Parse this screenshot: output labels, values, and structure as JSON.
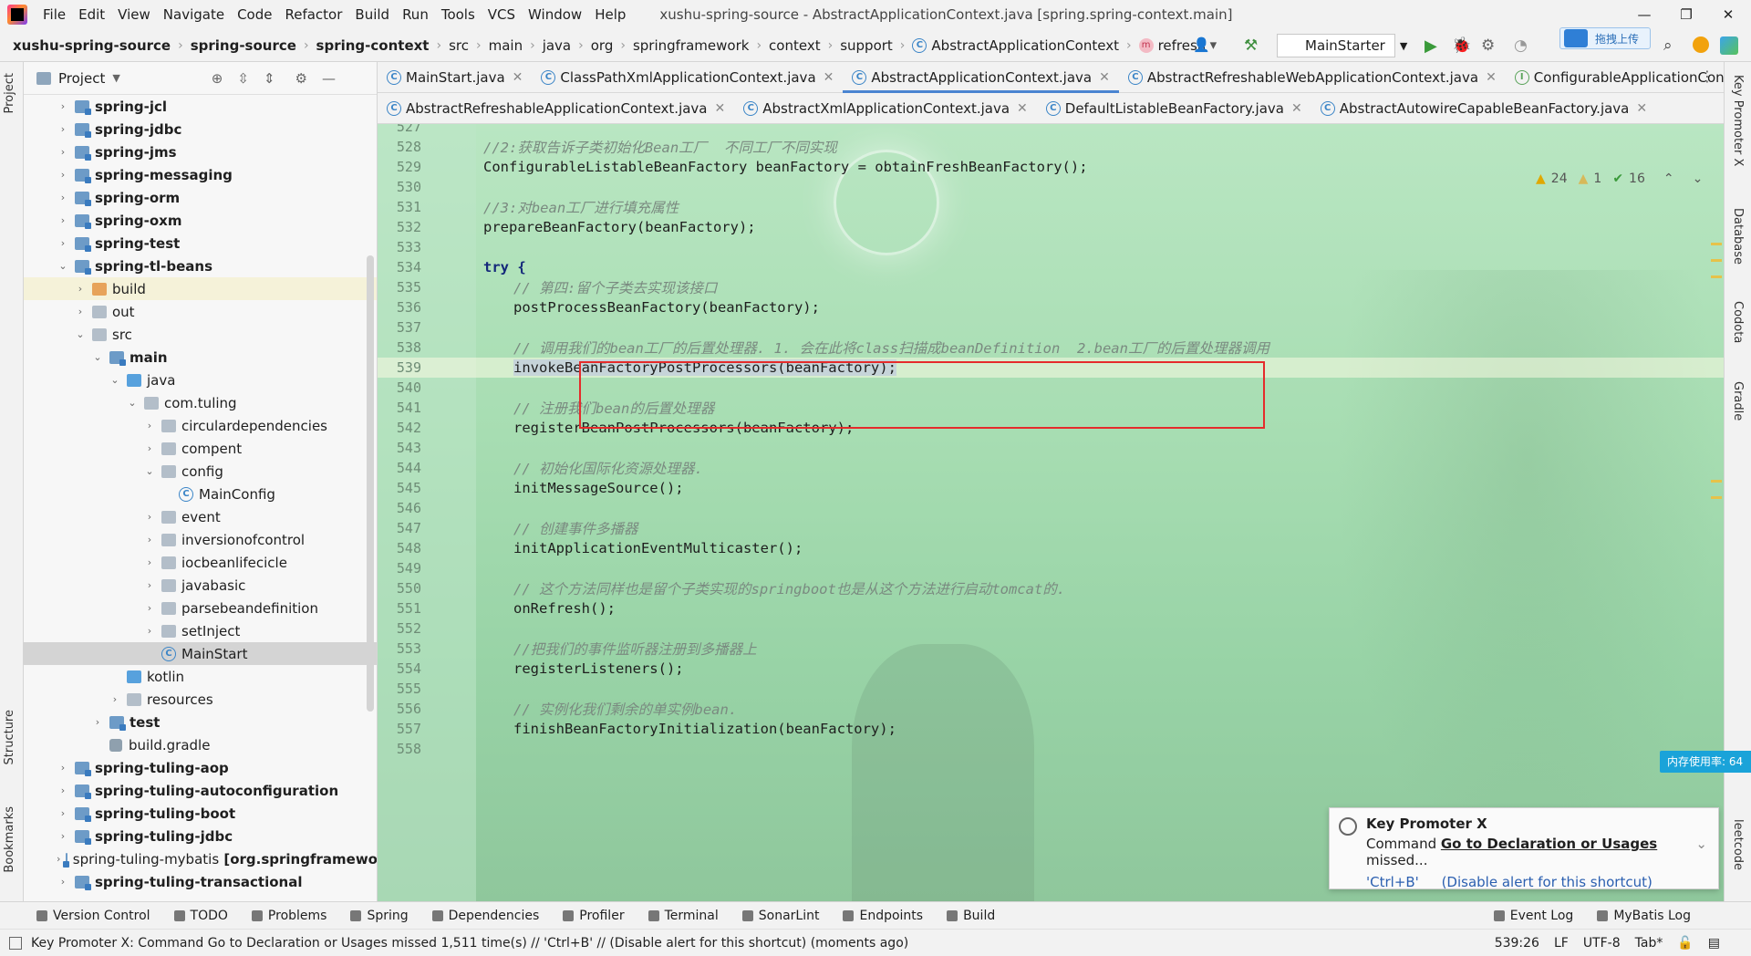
{
  "menubar": {
    "items": [
      "File",
      "Edit",
      "View",
      "Navigate",
      "Code",
      "Refactor",
      "Build",
      "Run",
      "Tools",
      "VCS",
      "Window",
      "Help"
    ],
    "title": "xushu-spring-source - AbstractApplicationContext.java [spring.spring-context.main]"
  },
  "navbar": {
    "crumbs": [
      "xushu-spring-source",
      "spring-source",
      "spring-context",
      "src",
      "main",
      "java",
      "org",
      "springframework",
      "context",
      "support"
    ],
    "class_name": "AbstractApplicationContext",
    "method_name": "refresh",
    "run_config": "MainStarter",
    "upload_badge": "拖拽上传"
  },
  "project": {
    "title": "Project",
    "tree": [
      {
        "label": "spring-jcl",
        "depth": 0,
        "type": "mod",
        "arrow": "›",
        "bold": true
      },
      {
        "label": "spring-jdbc",
        "depth": 0,
        "type": "mod",
        "arrow": "›",
        "bold": true
      },
      {
        "label": "spring-jms",
        "depth": 0,
        "type": "mod",
        "arrow": "›",
        "bold": true
      },
      {
        "label": "spring-messaging",
        "depth": 0,
        "type": "mod",
        "arrow": "›",
        "bold": true
      },
      {
        "label": "spring-orm",
        "depth": 0,
        "type": "mod",
        "arrow": "›",
        "bold": true
      },
      {
        "label": "spring-oxm",
        "depth": 0,
        "type": "mod",
        "arrow": "›",
        "bold": true
      },
      {
        "label": "spring-test",
        "depth": 0,
        "type": "mod",
        "arrow": "›",
        "bold": true
      },
      {
        "label": "spring-tl-beans",
        "depth": 0,
        "type": "mod",
        "arrow": "⌄",
        "bold": true
      },
      {
        "label": "build",
        "depth": 1,
        "type": "orange",
        "arrow": "›",
        "bold": false,
        "hl": true
      },
      {
        "label": "out",
        "depth": 1,
        "type": "plain",
        "arrow": "›",
        "bold": false
      },
      {
        "label": "src",
        "depth": 1,
        "type": "plain",
        "arrow": "⌄",
        "bold": false
      },
      {
        "label": "main",
        "depth": 2,
        "type": "mod",
        "arrow": "⌄",
        "bold": true
      },
      {
        "label": "java",
        "depth": 3,
        "type": "src",
        "arrow": "⌄",
        "bold": false
      },
      {
        "label": "com.tuling",
        "depth": 4,
        "type": "plain",
        "arrow": "⌄",
        "bold": false
      },
      {
        "label": "circulardependencies",
        "depth": 5,
        "type": "plain",
        "arrow": "›",
        "bold": false
      },
      {
        "label": "compent",
        "depth": 5,
        "type": "plain",
        "arrow": "›",
        "bold": false
      },
      {
        "label": "config",
        "depth": 5,
        "type": "plain",
        "arrow": "⌄",
        "bold": false
      },
      {
        "label": "MainConfig",
        "depth": 6,
        "type": "class",
        "arrow": "",
        "bold": false
      },
      {
        "label": "event",
        "depth": 5,
        "type": "plain",
        "arrow": "›",
        "bold": false
      },
      {
        "label": "inversionofcontrol",
        "depth": 5,
        "type": "plain",
        "arrow": "›",
        "bold": false
      },
      {
        "label": "iocbeanlifecicle",
        "depth": 5,
        "type": "plain",
        "arrow": "›",
        "bold": false
      },
      {
        "label": "javabasic",
        "depth": 5,
        "type": "plain",
        "arrow": "›",
        "bold": false
      },
      {
        "label": "parsebeandefinition",
        "depth": 5,
        "type": "plain",
        "arrow": "›",
        "bold": false
      },
      {
        "label": "setInject",
        "depth": 5,
        "type": "plain",
        "arrow": "›",
        "bold": false
      },
      {
        "label": "MainStart",
        "depth": 5,
        "type": "class",
        "arrow": "",
        "bold": false,
        "sel": true
      },
      {
        "label": "kotlin",
        "depth": 3,
        "type": "src",
        "arrow": "",
        "bold": false
      },
      {
        "label": "resources",
        "depth": 3,
        "type": "plain",
        "arrow": "›",
        "bold": false
      },
      {
        "label": "test",
        "depth": 2,
        "type": "mod",
        "arrow": "›",
        "bold": true
      },
      {
        "label": "build.gradle",
        "depth": 2,
        "type": "gradle",
        "arrow": "",
        "bold": false
      },
      {
        "label": "spring-tuling-aop",
        "depth": 0,
        "type": "mod",
        "arrow": "›",
        "bold": true
      },
      {
        "label": "spring-tuling-autoconfiguration",
        "depth": 0,
        "type": "mod",
        "arrow": "›",
        "bold": true
      },
      {
        "label": "spring-tuling-boot",
        "depth": 0,
        "type": "mod",
        "arrow": "›",
        "bold": true
      },
      {
        "label": "spring-tuling-jdbc",
        "depth": 0,
        "type": "mod",
        "arrow": "›",
        "bold": true
      },
      {
        "label": "spring-tuling-mybatis",
        "suffix": " [org.springframewo",
        "depth": 0,
        "type": "mod",
        "arrow": "›",
        "bold": false
      },
      {
        "label": "spring-tuling-transactional",
        "depth": 0,
        "type": "mod",
        "arrow": "›",
        "bold": true
      }
    ]
  },
  "tabs_row1": [
    {
      "label": "MainStart.java",
      "icon": "C",
      "active": false
    },
    {
      "label": "ClassPathXmlApplicationContext.java",
      "icon": "C",
      "active": false
    },
    {
      "label": "AbstractApplicationContext.java",
      "icon": "C",
      "active": true
    },
    {
      "label": "AbstractRefreshableWebApplicationContext.java",
      "icon": "C",
      "active": false
    },
    {
      "label": "ConfigurableApplicationContext.java",
      "icon": "I",
      "active": false
    }
  ],
  "tabs_row2": [
    {
      "label": "AbstractRefreshableApplicationContext.java",
      "icon": "C"
    },
    {
      "label": "AbstractXmlApplicationContext.java",
      "icon": "C"
    },
    {
      "label": "DefaultListableBeanFactory.java",
      "icon": "C"
    },
    {
      "label": "AbstractAutowireCapableBeanFactory.java",
      "icon": "C"
    }
  ],
  "inspections": {
    "warnings": "24",
    "weak": "1",
    "ok": "16"
  },
  "code_lines": [
    {
      "n": "527",
      "text": "",
      "indent": 0,
      "kind": "code"
    },
    {
      "n": "528",
      "text": "//2:获取告诉子类初始化Bean工厂  不同工厂不同实现",
      "indent": 0,
      "kind": "comment"
    },
    {
      "n": "529",
      "text": "ConfigurableListableBeanFactory beanFactory = obtainFreshBeanFactory();",
      "indent": 0,
      "kind": "code"
    },
    {
      "n": "530",
      "text": "",
      "indent": 0,
      "kind": "code"
    },
    {
      "n": "531",
      "text": "//3:对bean工厂进行填充属性",
      "indent": 0,
      "kind": "comment"
    },
    {
      "n": "532",
      "text": "prepareBeanFactory(beanFactory);",
      "indent": 0,
      "kind": "code"
    },
    {
      "n": "533",
      "text": "",
      "indent": 0,
      "kind": "code"
    },
    {
      "n": "534",
      "text": "try {",
      "indent": 0,
      "kind": "kw"
    },
    {
      "n": "535",
      "text": "// 第四:留个子类去实现该接口",
      "indent": 1,
      "kind": "comment"
    },
    {
      "n": "536",
      "text": "postProcessBeanFactory(beanFactory);",
      "indent": 1,
      "kind": "code"
    },
    {
      "n": "537",
      "text": "",
      "indent": 1,
      "kind": "code"
    },
    {
      "n": "538",
      "text": "// 调用我们的bean工厂的后置处理器. 1. 会在此将class扫描成beanDefinition  2.bean工厂的后置处理器调用",
      "indent": 1,
      "kind": "comment"
    },
    {
      "n": "539",
      "text": "invokeBeanFactoryPostProcessors(beanFactory);",
      "indent": 1,
      "kind": "code",
      "current": true
    },
    {
      "n": "540",
      "text": "",
      "indent": 1,
      "kind": "code"
    },
    {
      "n": "541",
      "text": "// 注册我们bean的后置处理器",
      "indent": 1,
      "kind": "comment"
    },
    {
      "n": "542",
      "text": "registerBeanPostProcessors(beanFactory);",
      "indent": 1,
      "kind": "code"
    },
    {
      "n": "543",
      "text": "",
      "indent": 1,
      "kind": "code"
    },
    {
      "n": "544",
      "text": "// 初始化国际化资源处理器.",
      "indent": 1,
      "kind": "comment"
    },
    {
      "n": "545",
      "text": "initMessageSource();",
      "indent": 1,
      "kind": "code"
    },
    {
      "n": "546",
      "text": "",
      "indent": 1,
      "kind": "code"
    },
    {
      "n": "547",
      "text": "// 创建事件多播器",
      "indent": 1,
      "kind": "comment"
    },
    {
      "n": "548",
      "text": "initApplicationEventMulticaster();",
      "indent": 1,
      "kind": "code"
    },
    {
      "n": "549",
      "text": "",
      "indent": 1,
      "kind": "code"
    },
    {
      "n": "550",
      "text": "// 这个方法同样也是留个子类实现的springboot也是从这个方法进行启动tomcat的.",
      "indent": 1,
      "kind": "comment"
    },
    {
      "n": "551",
      "text": "onRefresh();",
      "indent": 1,
      "kind": "code"
    },
    {
      "n": "552",
      "text": "",
      "indent": 1,
      "kind": "code"
    },
    {
      "n": "553",
      "text": "//把我们的事件监听器注册到多播器上",
      "indent": 1,
      "kind": "comment"
    },
    {
      "n": "554",
      "text": "registerListeners();",
      "indent": 1,
      "kind": "code"
    },
    {
      "n": "555",
      "text": "",
      "indent": 1,
      "kind": "code"
    },
    {
      "n": "556",
      "text": "// 实例化我们剩余的单实例bean.",
      "indent": 1,
      "kind": "comment"
    },
    {
      "n": "557",
      "text": "finishBeanFactoryInitialization(beanFactory);",
      "indent": 1,
      "kind": "code"
    },
    {
      "n": "558",
      "text": "",
      "indent": 1,
      "kind": "code"
    }
  ],
  "left_strip": {
    "project": "Project",
    "structure": "Structure",
    "bookmarks": "Bookmarks"
  },
  "right_strip": {
    "key_promoter": "Key Promoter X",
    "database": "Database",
    "codota": "Codota",
    "gradle": "Gradle",
    "leetcode": "leetcode"
  },
  "memory_badge": "内存使用率: 64",
  "notification": {
    "title": "Key Promoter X",
    "msg_prefix": "Command ",
    "msg_bold": "Go to Declaration or Usages",
    "msg_suffix": " missed...",
    "shortcut": "'Ctrl+B'",
    "disable": "(Disable alert for this shortcut)"
  },
  "toolwindows": [
    "Version Control",
    "TODO",
    "Problems",
    "Spring",
    "Dependencies",
    "Profiler",
    "Terminal",
    "SonarLint",
    "Endpoints",
    "Build"
  ],
  "toolwindows_right": [
    "Event Log",
    "MyBatis Log"
  ],
  "status": {
    "message": "Key Promoter X: Command Go to Declaration or Usages missed 1,511 time(s) // 'Ctrl+B' // (Disable alert for this shortcut) (moments ago)",
    "position": "539:26",
    "line_sep": "LF",
    "encoding": "UTF-8",
    "indent": "Tab*"
  }
}
